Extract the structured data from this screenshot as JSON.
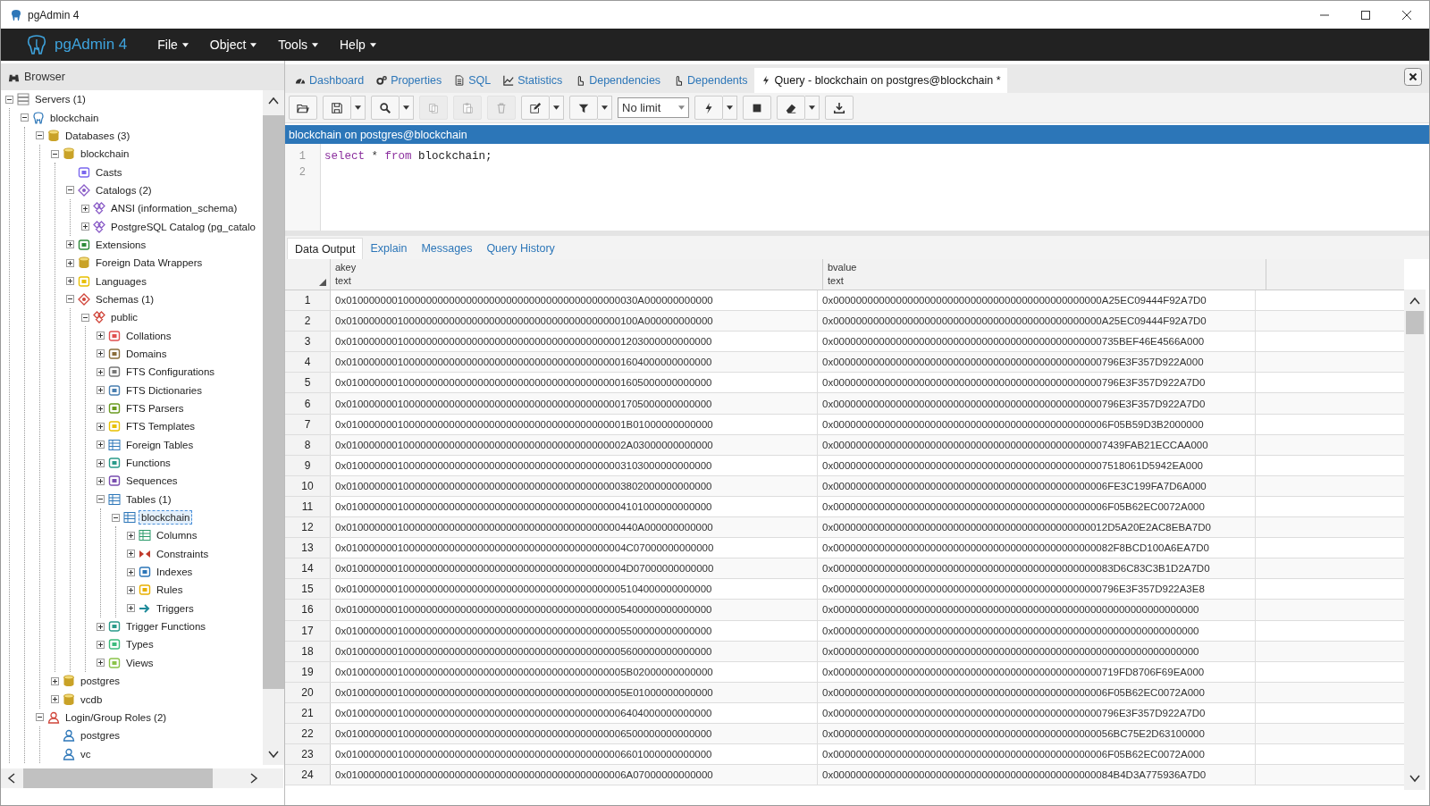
{
  "window": {
    "title": "pgAdmin 4"
  },
  "navbar": {
    "brand": "pgAdmin 4",
    "menus": [
      "File",
      "Object",
      "Tools",
      "Help"
    ]
  },
  "browser": {
    "title": "Browser",
    "tree": [
      {
        "label": "Servers (1)",
        "kind": "servers",
        "expanded": true,
        "selected": false,
        "children": [
          {
            "label": "blockchain",
            "kind": "server",
            "expanded": true,
            "selected": false,
            "children": [
              {
                "label": "Databases (3)",
                "kind": "databases",
                "expanded": true,
                "selected": false,
                "children": [
                  {
                    "label": "blockchain",
                    "kind": "database",
                    "expanded": true,
                    "selected": false,
                    "children": [
                      {
                        "label": "Casts",
                        "kind": "casts",
                        "selected": false
                      },
                      {
                        "label": "Catalogs (2)",
                        "kind": "catalogs",
                        "expanded": true,
                        "selected": false,
                        "children": [
                          {
                            "label": "ANSI (information_schema)",
                            "kind": "catalog",
                            "expanded": false,
                            "selected": false
                          },
                          {
                            "label": "PostgreSQL Catalog (pg_catalo",
                            "kind": "catalog",
                            "expanded": false,
                            "selected": false
                          }
                        ]
                      },
                      {
                        "label": "Extensions",
                        "kind": "extensions",
                        "expanded": false,
                        "selected": false
                      },
                      {
                        "label": "Foreign Data Wrappers",
                        "kind": "fdw",
                        "expanded": false,
                        "selected": false
                      },
                      {
                        "label": "Languages",
                        "kind": "languages",
                        "expanded": false,
                        "selected": false
                      },
                      {
                        "label": "Schemas (1)",
                        "kind": "schemas",
                        "expanded": true,
                        "selected": false,
                        "children": [
                          {
                            "label": "public",
                            "kind": "schema",
                            "expanded": true,
                            "selected": false,
                            "children": [
                              {
                                "label": "Collations",
                                "kind": "collations",
                                "expanded": false,
                                "selected": false
                              },
                              {
                                "label": "Domains",
                                "kind": "domains",
                                "expanded": false,
                                "selected": false
                              },
                              {
                                "label": "FTS Configurations",
                                "kind": "fts_config",
                                "expanded": false,
                                "selected": false
                              },
                              {
                                "label": "FTS Dictionaries",
                                "kind": "fts_dict",
                                "expanded": false,
                                "selected": false
                              },
                              {
                                "label": "FTS Parsers",
                                "kind": "fts_parser",
                                "expanded": false,
                                "selected": false
                              },
                              {
                                "label": "FTS Templates",
                                "kind": "fts_template",
                                "expanded": false,
                                "selected": false
                              },
                              {
                                "label": "Foreign Tables",
                                "kind": "foreign_tables",
                                "expanded": false,
                                "selected": false
                              },
                              {
                                "label": "Functions",
                                "kind": "functions",
                                "expanded": false,
                                "selected": false
                              },
                              {
                                "label": "Sequences",
                                "kind": "sequences",
                                "expanded": false,
                                "selected": false
                              },
                              {
                                "label": "Tables (1)",
                                "kind": "tables",
                                "expanded": true,
                                "selected": false,
                                "children": [
                                  {
                                    "label": "blockchain",
                                    "kind": "table",
                                    "expanded": true,
                                    "selected": true,
                                    "children": [
                                      {
                                        "label": "Columns",
                                        "kind": "columns",
                                        "expanded": false,
                                        "selected": false
                                      },
                                      {
                                        "label": "Constraints",
                                        "kind": "constraints",
                                        "expanded": false,
                                        "selected": false
                                      },
                                      {
                                        "label": "Indexes",
                                        "kind": "indexes",
                                        "expanded": false,
                                        "selected": false
                                      },
                                      {
                                        "label": "Rules",
                                        "kind": "rules",
                                        "expanded": false,
                                        "selected": false
                                      },
                                      {
                                        "label": "Triggers",
                                        "kind": "triggers",
                                        "expanded": false,
                                        "selected": false
                                      }
                                    ]
                                  }
                                ]
                              },
                              {
                                "label": "Trigger Functions",
                                "kind": "trigger_functions",
                                "expanded": false,
                                "selected": false
                              },
                              {
                                "label": "Types",
                                "kind": "types",
                                "expanded": false,
                                "selected": false
                              },
                              {
                                "label": "Views",
                                "kind": "views",
                                "expanded": false,
                                "selected": false
                              }
                            ]
                          }
                        ]
                      }
                    ]
                  },
                  {
                    "label": "postgres",
                    "kind": "database",
                    "expanded": false,
                    "selected": false
                  },
                  {
                    "label": "vcdb",
                    "kind": "database",
                    "expanded": false,
                    "selected": false
                  }
                ]
              },
              {
                "label": "Login/Group Roles (2)",
                "kind": "roles",
                "expanded": true,
                "selected": false,
                "children": [
                  {
                    "label": "postgres",
                    "kind": "role",
                    "selected": false
                  },
                  {
                    "label": "vc",
                    "kind": "role",
                    "selected": false
                  }
                ]
              }
            ]
          }
        ]
      }
    ]
  },
  "tabs": [
    {
      "label": "Dashboard",
      "kind": "dashboard",
      "selected": false
    },
    {
      "label": "Properties",
      "kind": "properties",
      "selected": false
    },
    {
      "label": "SQL",
      "kind": "sql",
      "selected": false
    },
    {
      "label": "Statistics",
      "kind": "statistics",
      "selected": false
    },
    {
      "label": "Dependencies",
      "kind": "dependencies",
      "selected": false
    },
    {
      "label": "Dependents",
      "kind": "dependents",
      "selected": false
    },
    {
      "label": "Query - blockchain on postgres@blockchain *",
      "kind": "query",
      "selected": true
    }
  ],
  "toolbar": [
    {
      "kind": "open",
      "disabled": false,
      "menu": false
    },
    {
      "kind": "save",
      "disabled": false,
      "menu": true
    },
    {
      "kind": "search",
      "disabled": false,
      "menu": true
    },
    {
      "kind": "copy",
      "disabled": true,
      "menu": false
    },
    {
      "kind": "paste",
      "disabled": true,
      "menu": false
    },
    {
      "kind": "delete",
      "disabled": true,
      "menu": false
    },
    {
      "kind": "edit",
      "disabled": false,
      "menu": true
    },
    {
      "kind": "filter",
      "disabled": false,
      "menu": true
    },
    {
      "kind": "limit",
      "value": "No limit"
    },
    {
      "kind": "execute",
      "disabled": false,
      "menu": true
    },
    {
      "kind": "stop",
      "disabled": false,
      "menu": false
    },
    {
      "kind": "clear",
      "disabled": false,
      "menu": true
    },
    {
      "kind": "download",
      "disabled": false,
      "menu": false
    }
  ],
  "query": {
    "title": "blockchain on postgres@blockchain",
    "line_numbers": [
      "1",
      "2"
    ],
    "lines": [
      [
        {
          "text": "select",
          "kind": "keyword"
        },
        {
          "text": "*",
          "kind": "operator"
        },
        {
          "text": "from",
          "kind": "keyword"
        },
        {
          "text": "blockchain;",
          "kind": "plain"
        }
      ]
    ]
  },
  "result_tabs": [
    {
      "label": "Data Output",
      "selected": true
    },
    {
      "label": "Explain",
      "selected": false
    },
    {
      "label": "Messages",
      "selected": false
    },
    {
      "label": "Query History",
      "selected": false
    }
  ],
  "grid": {
    "columns": [
      {
        "name": "akey",
        "type": "text"
      },
      {
        "name": "bvalue",
        "type": "text"
      }
    ],
    "rows": [
      {
        "number": "1",
        "cells": [
          "0x010000000100000000000000000000000000000000000000030A000000000000",
          "0x00000000000000000000000000000000000000000000000A25EC09444F92A7D0"
        ]
      },
      {
        "number": "2",
        "cells": [
          "0x010000000100000000000000000000000000000000000000100A000000000000",
          "0x00000000000000000000000000000000000000000000000A25EC09444F92A7D0"
        ]
      },
      {
        "number": "3",
        "cells": [
          "0x0100000001000000000000000000000000000000000000001203000000000000",
          "0x00000000000000000000000000000000000000000000000735BEF46E4566A000"
        ]
      },
      {
        "number": "4",
        "cells": [
          "0x0100000001000000000000000000000000000000000000001604000000000000",
          "0x00000000000000000000000000000000000000000000000796E3F357D922A000"
        ]
      },
      {
        "number": "5",
        "cells": [
          "0x0100000001000000000000000000000000000000000000001605000000000000",
          "0x00000000000000000000000000000000000000000000000796E3F357D922A7D0"
        ]
      },
      {
        "number": "6",
        "cells": [
          "0x0100000001000000000000000000000000000000000000001705000000000000",
          "0x00000000000000000000000000000000000000000000000796E3F357D922A7D0"
        ]
      },
      {
        "number": "7",
        "cells": [
          "0x0100000001000000000000000000000000000000000000001B01000000000000",
          "0x000000000000000000000000000000000000000000000006F05B59D3B2000000"
        ]
      },
      {
        "number": "8",
        "cells": [
          "0x0100000001000000000000000000000000000000000000002A03000000000000",
          "0x000000000000000000000000000000000000000000000007439FAB21ECCAA000"
        ]
      },
      {
        "number": "9",
        "cells": [
          "0x0100000001000000000000000000000000000000000000003103000000000000",
          "0x000000000000000000000000000000000000000000000007518061D5942EA000"
        ]
      },
      {
        "number": "10",
        "cells": [
          "0x0100000001000000000000000000000000000000000000003802000000000000",
          "0x000000000000000000000000000000000000000000000006FE3C199FA7D6A000"
        ]
      },
      {
        "number": "11",
        "cells": [
          "0x0100000001000000000000000000000000000000000000004101000000000000",
          "0x000000000000000000000000000000000000000000000006F05B62EC0072A000"
        ]
      },
      {
        "number": "12",
        "cells": [
          "0x010000000100000000000000000000000000000000000000440A000000000000",
          "0x000000000000000000000000000000000000000000000012D5A20E2AC8EBA7D0"
        ]
      },
      {
        "number": "13",
        "cells": [
          "0x0100000001000000000000000000000000000000000000004C07000000000000",
          "0x0000000000000000000000000000000000000000000000082F8BCD100A6EA7D0"
        ]
      },
      {
        "number": "14",
        "cells": [
          "0x0100000001000000000000000000000000000000000000004D07000000000000",
          "0x0000000000000000000000000000000000000000000000083D6C83C3B1D2A7D0"
        ]
      },
      {
        "number": "15",
        "cells": [
          "0x0100000001000000000000000000000000000000000000005104000000000000",
          "0x00000000000000000000000000000000000000000000000796E3F357D922A3E8"
        ]
      },
      {
        "number": "16",
        "cells": [
          "0x0100000001000000000000000000000000000000000000005400000000000000",
          "0x0000000000000000000000000000000000000000000000000000000000000000"
        ]
      },
      {
        "number": "17",
        "cells": [
          "0x0100000001000000000000000000000000000000000000005500000000000000",
          "0x0000000000000000000000000000000000000000000000000000000000000000"
        ]
      },
      {
        "number": "18",
        "cells": [
          "0x0100000001000000000000000000000000000000000000005600000000000000",
          "0x0000000000000000000000000000000000000000000000000000000000000000"
        ]
      },
      {
        "number": "19",
        "cells": [
          "0x0100000001000000000000000000000000000000000000005B02000000000000",
          "0x00000000000000000000000000000000000000000000000719FD8706F69EA000"
        ]
      },
      {
        "number": "20",
        "cells": [
          "0x0100000001000000000000000000000000000000000000005E01000000000000",
          "0x000000000000000000000000000000000000000000000006F05B62EC0072A000"
        ]
      },
      {
        "number": "21",
        "cells": [
          "0x0100000001000000000000000000000000000000000000006404000000000000",
          "0x00000000000000000000000000000000000000000000000796E3F357D922A7D0"
        ]
      },
      {
        "number": "22",
        "cells": [
          "0x0100000001000000000000000000000000000000000000006500000000000000",
          "0x0000000000000000000000000000000000000000000000056BC75E2D63100000"
        ]
      },
      {
        "number": "23",
        "cells": [
          "0x0100000001000000000000000000000000000000000000006601000000000000",
          "0x000000000000000000000000000000000000000000000006F05B62EC0072A000"
        ]
      },
      {
        "number": "24",
        "cells": [
          "0x0100000001000000000000000000000000000000000000006A07000000000000",
          "0x0000000000000000000000000000000000000000000000084B4D3A775936A7D0"
        ]
      }
    ]
  }
}
